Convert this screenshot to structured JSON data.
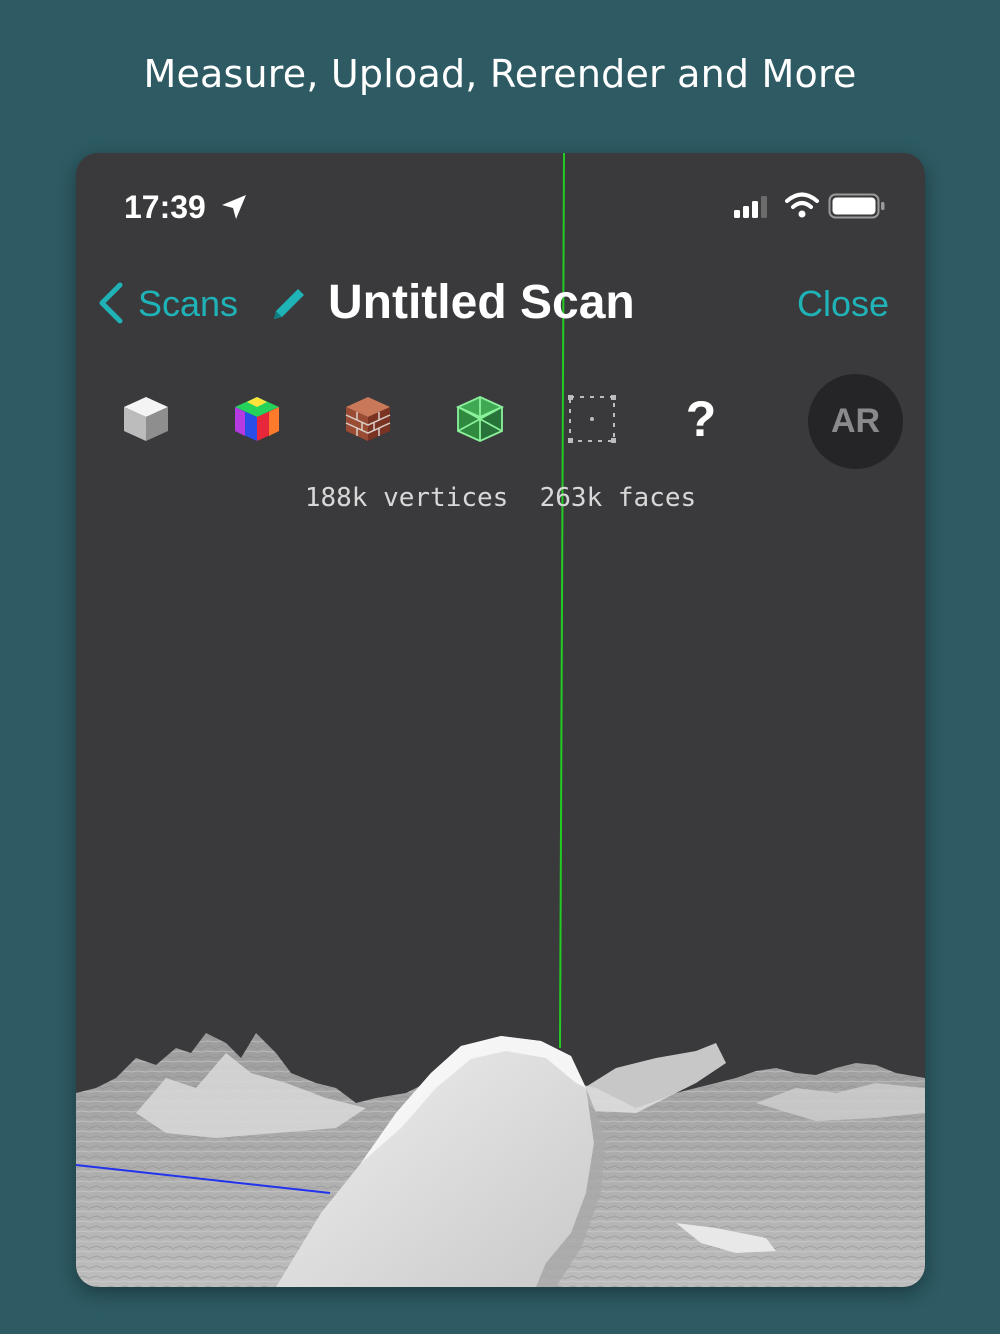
{
  "caption": "Measure, Upload, Rerender and More",
  "status_bar": {
    "time": "17:39",
    "icons": [
      "location-arrow-icon",
      "cellular-signal-icon",
      "wifi-icon",
      "battery-icon"
    ]
  },
  "nav": {
    "back_label": "Scans",
    "title": "Untitled Scan",
    "close_label": "Close",
    "accent_color": "#1fb3b8"
  },
  "toolbar": {
    "tools": [
      "solid-shading-icon",
      "vertex-color-icon",
      "texture-icon",
      "wireframe-icon",
      "bounding-box-icon",
      "help-icon"
    ],
    "help_label": "?",
    "ar_label": "AR"
  },
  "mesh_stats": {
    "text": "188k vertices  263k faces"
  },
  "viewport": {
    "y_axis_color": "#22cc22",
    "z_axis_color": "#2233ee",
    "background": "#3a3a3c"
  }
}
